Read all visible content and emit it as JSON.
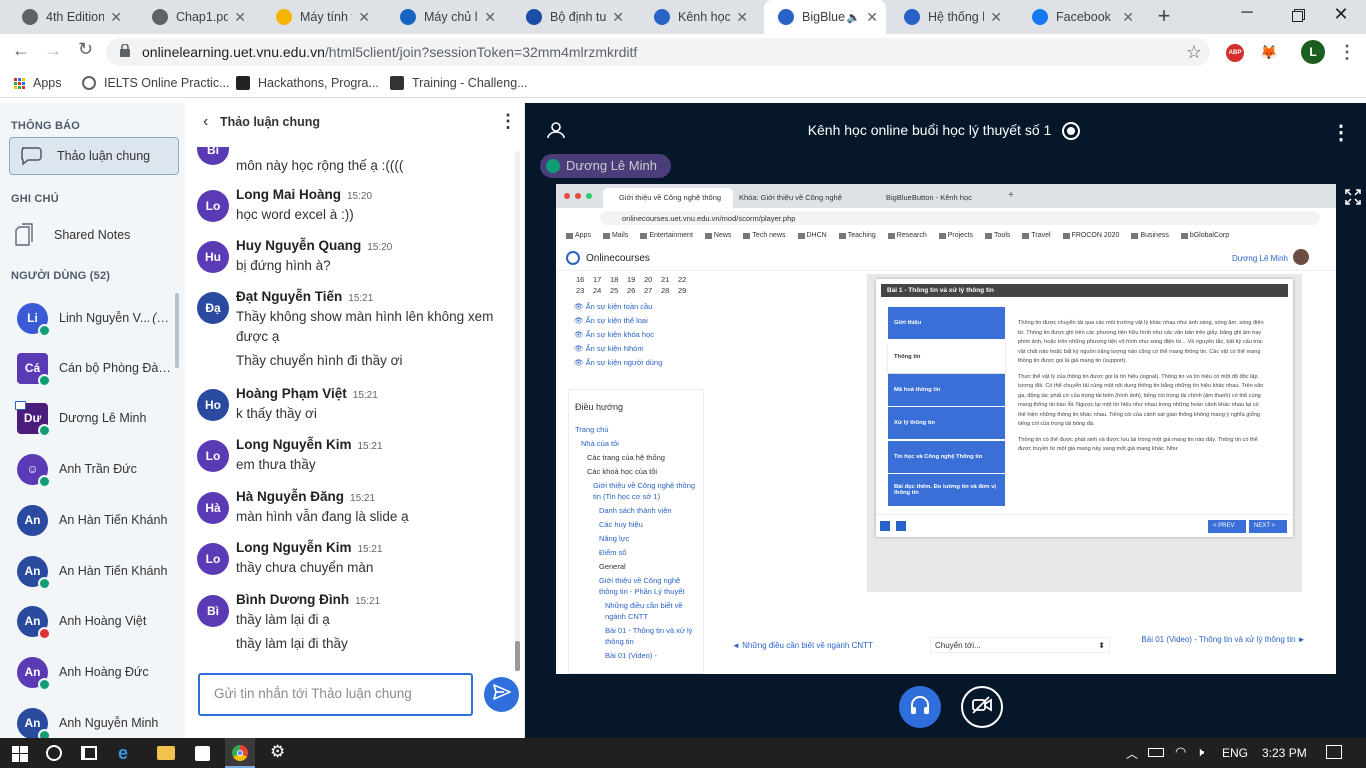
{
  "browser": {
    "tabs": [
      {
        "title": "4th Edition",
        "icon": "chrome-icon",
        "color": "#5f6368"
      },
      {
        "title": "Chap1.pdf",
        "icon": "globe-icon",
        "color": "#5f6368"
      },
      {
        "title": "Máy tính tra",
        "icon": "calc-icon",
        "color": "#f4b400"
      },
      {
        "title": "Máy chủ lá",
        "icon": "x-logo-icon",
        "color": "#1565c0"
      },
      {
        "title": "Bộ định tuy",
        "icon": "net-icon",
        "color": "#1a4ea8"
      },
      {
        "title": "Kênh học o",
        "icon": "bbb-icon",
        "color": "#2a63c7"
      },
      {
        "title": "BigBlue",
        "icon": "bbb-icon",
        "color": "#2a63c7",
        "active": true
      },
      {
        "title": "Hệ thống h",
        "icon": "bbb-icon",
        "color": "#2a63c7"
      },
      {
        "title": "Facebook",
        "icon": "facebook-icon",
        "color": "#1877f2"
      }
    ],
    "url_domain": "onlinelearning.uet.vnu.edu.vn",
    "url_path": "/html5client/join?sessionToken=32mm4mlrzmkrditf",
    "bookmarks": [
      "Apps",
      "IELTS Online Practic...",
      "Hackathons, Progra...",
      "Training - Challeng..."
    ],
    "profile_initial": "L",
    "ext_abp": "ABP"
  },
  "left": {
    "notif_title": "THÔNG BÁO",
    "public_chat": "Thảo luận chung",
    "notes_title": "GHI CHÚ",
    "shared_notes": "Shared Notes",
    "users_title": "NGƯỜI DÙNG (52)",
    "users": [
      {
        "initials": "Li",
        "name": "Linh Nguyễn V...",
        "suffix": "(Bạn)",
        "color": "#3b5bd6",
        "badge": "green"
      },
      {
        "initials": "Cá",
        "name": "Cán bộ Phòng Đào t...",
        "color": "#5a3bb5",
        "square": true,
        "badge": "green"
      },
      {
        "initials": "Dư",
        "name": "Dương Lê Minh",
        "color": "#4a1c7c",
        "square": true,
        "badge": "green",
        "presenter": true
      },
      {
        "initials": "☺",
        "name": "Anh Trần Đức",
        "color": "#5a3bb5",
        "badge": "green"
      },
      {
        "initials": "An",
        "name": "An Hàn Tiến Khánh",
        "color": "#2a4aa0",
        "badge": "none"
      },
      {
        "initials": "An",
        "name": "An Hàn Tiến Khánh",
        "color": "#2a4aa0",
        "badge": "green"
      },
      {
        "initials": "An",
        "name": "Anh Hoàng Việt",
        "color": "#2a4aa0",
        "badge": "red"
      },
      {
        "initials": "An",
        "name": "Anh Hoàng Đức",
        "color": "#5a3bb5",
        "badge": "green"
      },
      {
        "initials": "An",
        "name": "Anh Nguyễn Minh",
        "color": "#2a4aa0",
        "badge": "green"
      }
    ]
  },
  "chat": {
    "title": "Thảo luận chung",
    "first_text": "môn này học rộng thế ạ :((((",
    "messages": [
      {
        "initials": "Lo",
        "name": "Long Mai Hoàng",
        "time": "15:20",
        "lines": [
          "học word excel à :))"
        ]
      },
      {
        "initials": "Hu",
        "name": "Huy Nguyễn Quang",
        "time": "15:20",
        "lines": [
          "bị đứng hình à?"
        ]
      },
      {
        "initials": "Đạ",
        "name": "Đạt Nguyễn Tiến",
        "time": "15:21",
        "lines": [
          "Thầy không show màn hình lên không xem được ạ",
          "Thầy chuyển hình đi thầy ơi"
        ]
      },
      {
        "initials": "Ho",
        "name": "Hoàng Phạm Việt",
        "time": "15:21",
        "lines": [
          "k thấy thầy ơi"
        ]
      },
      {
        "initials": "Lo",
        "name": "Long Nguyễn Kim",
        "time": "15:21",
        "lines": [
          "em thưa thầy"
        ]
      },
      {
        "initials": "Hà",
        "name": "Hà Nguyễn Đăng",
        "time": "15:21",
        "lines": [
          "màn hình vẫn đang là slide ạ"
        ]
      },
      {
        "initials": "Lo",
        "name": "Long Nguyễn Kim",
        "time": "15:21",
        "lines": [
          "thầy chưa chuyển màn"
        ]
      },
      {
        "initials": "Bì",
        "name": "Bình Dương Đình",
        "time": "15:21",
        "lines": [
          "thầy làm lại đi ạ",
          "thầy làm lại đi thầy"
        ]
      }
    ],
    "input_placeholder": "Gửi tin nhắn tới Thảo luận chung"
  },
  "meeting": {
    "title": "Kênh học online buổi học lý thuyết số 1",
    "presenter": "Dương Lê Minh"
  },
  "shared_screen": {
    "tabs": [
      "Giới thiệu về Công nghệ thông",
      "Khóa: Giới thiệu về Công nghệ",
      "BigBlueButton - Kênh học"
    ],
    "url": "onlinecourses.uet.vnu.edu.vn/mod/scorm/player.php",
    "bookmarks": [
      "Apps",
      "Mails",
      "Entertainment",
      "News",
      "Tech news",
      "DHCN",
      "Teaching",
      "Research",
      "Projects",
      "Tools",
      "Travel",
      "FROCON 2020",
      "Business",
      "bGlobalCorp"
    ],
    "site_name": "Onlinecourses",
    "site_user": "Dương Lê Minh",
    "calendar_rows": [
      [
        "16",
        "17",
        "18",
        "19",
        "20",
        "21",
        "22"
      ],
      [
        "23",
        "24",
        "25",
        "26",
        "27",
        "28",
        "29"
      ]
    ],
    "events": [
      "Ẩn sự kiện toàn cầu",
      "Ẩn sự kiện thể loại",
      "Ẩn sự kiện khóa học",
      "Ẩn sự kiện Nhóm",
      "Ẩn sự kiện người dùng"
    ],
    "nav_title": "Điều hướng",
    "nav_items": [
      "Trang chủ",
      "Nhà của tôi",
      "Các trang của hệ thống",
      "Các khoá học của tôi",
      "Giới thiệu về Công nghệ thông tin (Tin học cơ sở 1)",
      "Danh sách thành viên",
      "Các huy hiệu",
      "Năng lực",
      "Điểm số",
      "General",
      "Giới thiệu về Công nghệ thông tin - Phần Lý thuyết",
      "Những điều cần biết về ngành CNTT",
      "Bài 01 - Thông tin và xử lý thông tin",
      "Bài 01 (Video) -"
    ],
    "slide_title": "Bài 1 - Thông tin và xử lý thông tin",
    "slide_menu": [
      "Giới thiệu",
      "Thông tin",
      "Mã hoá thông tin",
      "Xử lý thông tin",
      "Tin học và Công nghệ Thông tin",
      "Bài đọc thêm. Đo lường tin và đơn vị thông tin"
    ],
    "slide_p1": "Thông tin được chuyển tải qua các môi trường vật lý khác nhau như ánh sáng, sóng âm, sóng điện từ. Thông tin được ghi trên các phương tiện hữu hình như các văn bản trên giấy, băng ghi âm hay phim ảnh, hoặc trên những phương tiện vô hình như sóng điện từ... Về nguyên tắc, bất kỳ cấu trúc vật chất nào hoặc bất kỳ nguồn năng lượng nào cũng có thể mang thông tin. Các vật có thể mang thông tin được gọi là giá mang tin (support).",
    "slide_p2": "Thực thể vật lý của thông tin được gọi là tín hiệu (signal). Thông tin và tín hiệu có một độ độc lập tương đối. Có thể chuyển tải cùng một nội dung thông tin bằng những tín hiệu khác nhau. Trên sân ga, động tác phất cờ của trọng tài biên (hình ảnh), tiếng còi trọng tài chính (âm thanh) có thể cùng mang thông tin báo lỗi. Ngược lại một tín hiệu như nhau trong những hoàn cảnh khác nhau lại có thể hiện những thông tin khác nhau. Tiếng còi của cảnh sát giao thông không mang ý nghĩa giống tiếng còi của trọng tài bóng đá.",
    "slide_p3": "Thông tin có thể được phát sinh và được lưu lại trong một giá mang tin nào đấy. Thông tin có thể được truyền từ một giá mang này sang một giá mang khác. Như",
    "prev": "< PREV",
    "next": "NEXT >",
    "bottom_left": "◄ Những điều cần biết về ngành CNTT",
    "bottom_select": "Chuyển tới...",
    "bottom_right": "Bài 01 (Video) - Thông tin và xử lý thông tin ►"
  },
  "taskbar": {
    "lang": "ENG",
    "time": "3:23 PM"
  }
}
